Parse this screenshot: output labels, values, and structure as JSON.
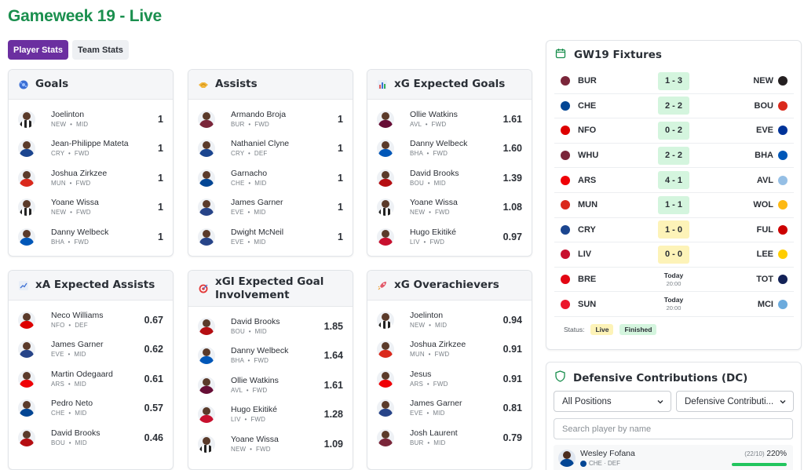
{
  "page": {
    "title": "Gameweek 19 - Live"
  },
  "tabs": [
    {
      "label": "Player Stats",
      "active": true
    },
    {
      "label": "Team Stats",
      "active": false
    }
  ],
  "colors": {
    "brand_green": "#1a8f4e",
    "active_tab": "#6b2fa0",
    "finished": "#d4f5de",
    "live": "#fdf3b8"
  },
  "cards": {
    "goals": {
      "title": "Goals",
      "icon": "soccer-ball-icon",
      "players": [
        {
          "name": "Joelinton",
          "team": "NEW",
          "pos": "MID",
          "value": "1"
        },
        {
          "name": "Jean-Philippe Mateta",
          "team": "CRY",
          "pos": "FWD",
          "value": "1"
        },
        {
          "name": "Joshua Zirkzee",
          "team": "MUN",
          "pos": "FWD",
          "value": "1"
        },
        {
          "name": "Yoane Wissa",
          "team": "NEW",
          "pos": "FWD",
          "value": "1"
        },
        {
          "name": "Danny Welbeck",
          "team": "BHA",
          "pos": "FWD",
          "value": "1"
        }
      ]
    },
    "assists": {
      "title": "Assists",
      "icon": "handshake-icon",
      "players": [
        {
          "name": "Armando Broja",
          "team": "BUR",
          "pos": "FWD",
          "value": "1"
        },
        {
          "name": "Nathaniel Clyne",
          "team": "CRY",
          "pos": "DEF",
          "value": "1"
        },
        {
          "name": "Garnacho",
          "team": "CHE",
          "pos": "MID",
          "value": "1"
        },
        {
          "name": "James Garner",
          "team": "EVE",
          "pos": "MID",
          "value": "1"
        },
        {
          "name": "Dwight McNeil",
          "team": "EVE",
          "pos": "MID",
          "value": "1"
        }
      ]
    },
    "xg": {
      "title": "xG Expected Goals",
      "icon": "bar-chart-icon",
      "players": [
        {
          "name": "Ollie Watkins",
          "team": "AVL",
          "pos": "FWD",
          "value": "1.61"
        },
        {
          "name": "Danny Welbeck",
          "team": "BHA",
          "pos": "FWD",
          "value": "1.60"
        },
        {
          "name": "David Brooks",
          "team": "BOU",
          "pos": "MID",
          "value": "1.39"
        },
        {
          "name": "Yoane Wissa",
          "team": "NEW",
          "pos": "FWD",
          "value": "1.08"
        },
        {
          "name": "Hugo Ekitiké",
          "team": "LIV",
          "pos": "FWD",
          "value": "0.97"
        }
      ]
    },
    "xa": {
      "title": "xA Expected Assists",
      "icon": "trend-chart-icon",
      "players": [
        {
          "name": "Neco Williams",
          "team": "NFO",
          "pos": "DEF",
          "value": "0.67"
        },
        {
          "name": "James Garner",
          "team": "EVE",
          "pos": "MID",
          "value": "0.62"
        },
        {
          "name": "Martin Odegaard",
          "team": "ARS",
          "pos": "MID",
          "value": "0.61"
        },
        {
          "name": "Pedro Neto",
          "team": "CHE",
          "pos": "MID",
          "value": "0.57"
        },
        {
          "name": "David Brooks",
          "team": "BOU",
          "pos": "MID",
          "value": "0.46"
        }
      ]
    },
    "xgi": {
      "title": "xGI Expected Goal Involvement",
      "icon": "target-icon",
      "players": [
        {
          "name": "David Brooks",
          "team": "BOU",
          "pos": "MID",
          "value": "1.85"
        },
        {
          "name": "Danny Welbeck",
          "team": "BHA",
          "pos": "FWD",
          "value": "1.64"
        },
        {
          "name": "Ollie Watkins",
          "team": "AVL",
          "pos": "FWD",
          "value": "1.61"
        },
        {
          "name": "Hugo Ekitiké",
          "team": "LIV",
          "pos": "FWD",
          "value": "1.28"
        },
        {
          "name": "Yoane Wissa",
          "team": "NEW",
          "pos": "FWD",
          "value": "1.09"
        }
      ]
    },
    "xgo": {
      "title": "xG Overachievers",
      "icon": "rocket-icon",
      "players": [
        {
          "name": "Joelinton",
          "team": "NEW",
          "pos": "MID",
          "value": "0.94"
        },
        {
          "name": "Joshua Zirkzee",
          "team": "MUN",
          "pos": "FWD",
          "value": "0.91"
        },
        {
          "name": "Jesus",
          "team": "ARS",
          "pos": "FWD",
          "value": "0.91"
        },
        {
          "name": "James Garner",
          "team": "EVE",
          "pos": "MID",
          "value": "0.81"
        },
        {
          "name": "Josh Laurent",
          "team": "BUR",
          "pos": "MID",
          "value": "0.79"
        }
      ]
    }
  },
  "fixtures": {
    "title": "GW19 Fixtures",
    "rows": [
      {
        "home": "BUR",
        "away": "NEW",
        "score": "1 - 3",
        "state": "finished",
        "home_color": "#7a263a",
        "away_color": "#241f20"
      },
      {
        "home": "CHE",
        "away": "BOU",
        "score": "2 - 2",
        "state": "finished",
        "home_color": "#034694",
        "away_color": "#da291c"
      },
      {
        "home": "NFO",
        "away": "EVE",
        "score": "0 - 2",
        "state": "finished",
        "home_color": "#dd0000",
        "away_color": "#003399"
      },
      {
        "home": "WHU",
        "away": "BHA",
        "score": "2 - 2",
        "state": "finished",
        "home_color": "#7a263a",
        "away_color": "#0057b8"
      },
      {
        "home": "ARS",
        "away": "AVL",
        "score": "4 - 1",
        "state": "finished",
        "home_color": "#ef0107",
        "away_color": "#95bfe5"
      },
      {
        "home": "MUN",
        "away": "WOL",
        "score": "1 - 1",
        "state": "finished",
        "home_color": "#da291c",
        "away_color": "#fdb913"
      },
      {
        "home": "CRY",
        "away": "FUL",
        "score": "1 - 0",
        "state": "live",
        "home_color": "#1b458f",
        "away_color": "#cc0000"
      },
      {
        "home": "LIV",
        "away": "LEE",
        "score": "0 - 0",
        "state": "live",
        "home_color": "#c8102e",
        "away_color": "#ffcd00"
      },
      {
        "home": "BRE",
        "away": "TOT",
        "date": "Today",
        "time": "20:00",
        "state": "upcoming",
        "home_color": "#e30613",
        "away_color": "#132257"
      },
      {
        "home": "SUN",
        "away": "MCI",
        "date": "Today",
        "time": "20:00",
        "state": "upcoming",
        "home_color": "#eb172b",
        "away_color": "#6cabdd"
      }
    ],
    "status_label": "Status:",
    "live_label": "Live",
    "finished_label": "Finished"
  },
  "defensive": {
    "title": "Defensive Contributions (DC)",
    "position_select": "All Positions",
    "metric_select": "Defensive Contributi...",
    "search_placeholder": "Search player by name",
    "player": {
      "name": "Wesley Fofana",
      "meta": "CHE · DEF",
      "ratio": "(22/10)",
      "percent": "220%",
      "progress": 1.0
    }
  }
}
